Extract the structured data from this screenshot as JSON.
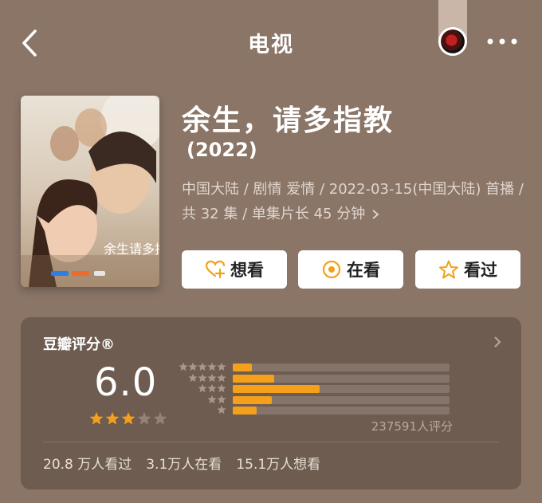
{
  "nav": {
    "title": "电视"
  },
  "movie": {
    "title": "余生，请多指教",
    "year": "(2022)",
    "meta_line": "中国大陆 / 剧情 爱情 / 2022-03-15(中国大陆) 首播 / 共 32 集 / 单集片长 45 分钟"
  },
  "poster": {
    "title_art": "余生请多指教"
  },
  "actions": {
    "want": "想看",
    "watching": "在看",
    "watched": "看过"
  },
  "rating": {
    "label": "豆瓣评分®",
    "score": "6.0",
    "stars_filled": 3,
    "stars_total": 5,
    "votes": "237591人评分",
    "distribution": [
      {
        "stars": 5,
        "fraction": 0.09
      },
      {
        "stars": 4,
        "fraction": 0.19
      },
      {
        "stars": 3,
        "fraction": 0.4
      },
      {
        "stars": 2,
        "fraction": 0.18
      },
      {
        "stars": 1,
        "fraction": 0.11
      }
    ],
    "stats": {
      "watched": "20.8 万人看过",
      "watching": "3.1万人在看",
      "want": "15.1万人想看"
    }
  },
  "colors": {
    "accent": "#f5a01a",
    "background": "#8a7567",
    "card": "#6e5c50"
  }
}
